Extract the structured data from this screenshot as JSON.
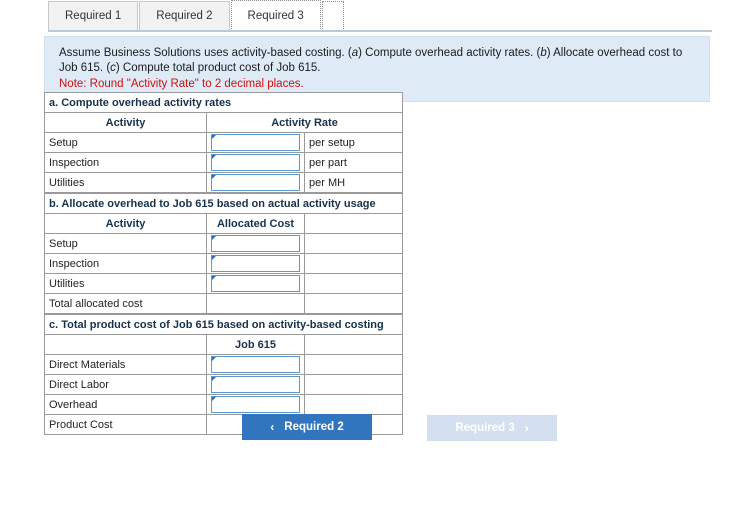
{
  "tabs": [
    {
      "label": "Required 1",
      "active": false
    },
    {
      "label": "Required 2",
      "active": false
    },
    {
      "label": "Required 3",
      "active": true
    }
  ],
  "instruction": {
    "line1_a": "Assume Business Solutions uses activity-based costing. (",
    "em_a": "a",
    "line1_b": ") Compute overhead activity rates. (",
    "em_b": "b",
    "line1_c": ") Allocate overhead cost to Job 615. (",
    "em_c": "c",
    "line1_d": ") Compute total product cost of Job 615.",
    "note": "Note: Round \"Activity Rate\" to 2 decimal places."
  },
  "section_a": {
    "title": "a. Compute overhead activity rates",
    "headers": [
      "Activity",
      "Activity Rate"
    ],
    "rows": [
      {
        "label": "Setup",
        "value": "",
        "unit": "per setup"
      },
      {
        "label": "Inspection",
        "value": "",
        "unit": "per part"
      },
      {
        "label": "Utilities",
        "value": "",
        "unit": "per MH"
      }
    ]
  },
  "section_b": {
    "title": "b. Allocate overhead to Job 615 based on actual activity usage",
    "headers": [
      "Activity",
      "Allocated Cost"
    ],
    "rows": [
      {
        "label": "Setup",
        "value": ""
      },
      {
        "label": "Inspection",
        "value": ""
      },
      {
        "label": "Utilities",
        "value": ""
      }
    ],
    "total_label": "Total allocated cost",
    "total_value": ""
  },
  "section_c": {
    "title": "c. Total product cost of Job 615 based on activity-based costing",
    "header_blank": "",
    "header_job": "Job 615",
    "rows": [
      {
        "label": "Direct Materials",
        "value": ""
      },
      {
        "label": "Direct Labor",
        "value": ""
      },
      {
        "label": "Overhead",
        "value": ""
      }
    ],
    "total_label": "Product Cost",
    "total_value": ""
  },
  "buttons": {
    "prev_label": "Required 2",
    "prev_chevron": "‹",
    "next_label": "Required 3",
    "next_chevron": "›"
  },
  "colors": {
    "header_blue": "#7eb2e4",
    "panel_blue": "#deeaf6",
    "primary_button": "#3075be",
    "disabled_button": "#d4dfef",
    "note_red": "#cc1111",
    "input_border": "#5b9bd5"
  }
}
